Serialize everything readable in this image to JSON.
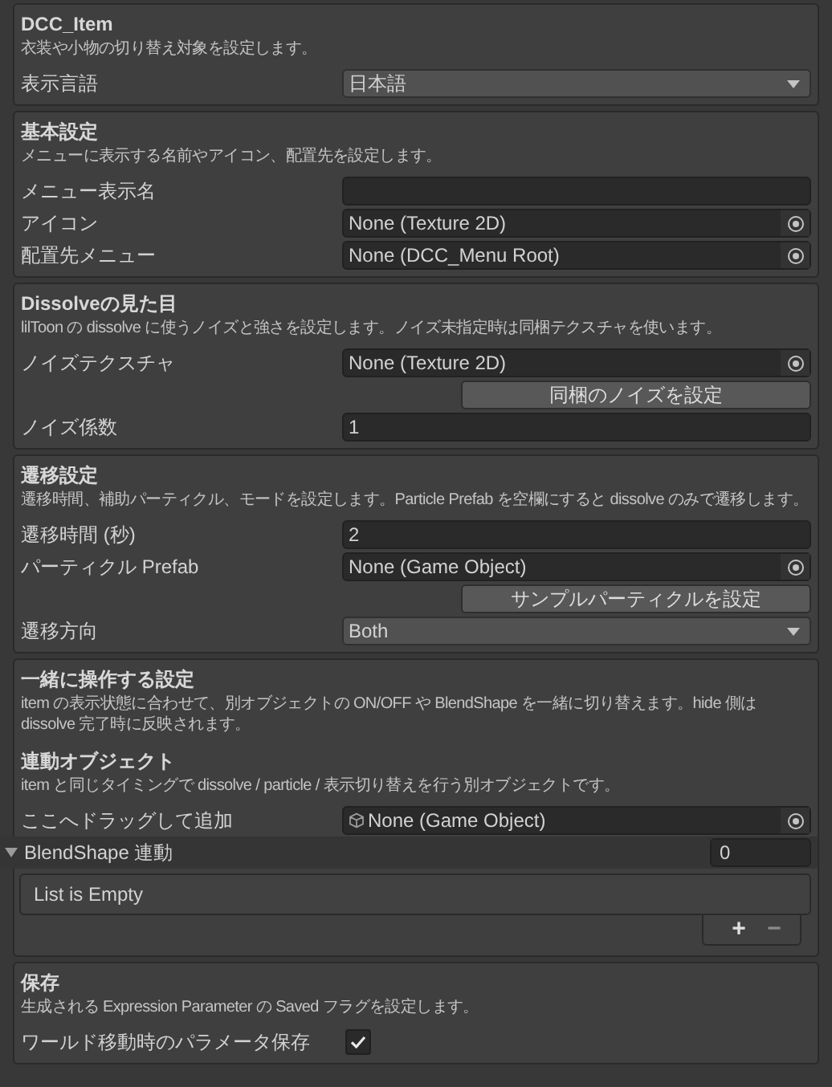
{
  "sections": [
    {
      "title": "DCC_Item",
      "description": "衣装や小物の切り替え対象を設定します。",
      "rows": [
        {
          "kind": "dropdown",
          "label": "表示言語",
          "value": "日本語"
        }
      ]
    },
    {
      "title": "基本設定",
      "description": "メニューに表示する名前やアイコン、配置先を設定します。",
      "rows": [
        {
          "kind": "text",
          "label": "メニュー表示名"
        },
        {
          "kind": "object",
          "label": "アイコン",
          "value": "None (Texture 2D)"
        },
        {
          "kind": "object",
          "label": "配置先メニュー",
          "value": "None (DCC_Menu Root)"
        }
      ]
    },
    {
      "title": "Dissolveの見た目",
      "description": "lilToon の dissolve に使うノイズと強さを設定します。ノイズ未指定時は同梱テクスチャを使います。",
      "rows": [
        {
          "kind": "object",
          "label": "ノイズテクスチャ",
          "value": "None (Texture 2D)"
        },
        {
          "kind": "button",
          "label": "同梱のノイズを設定"
        },
        {
          "kind": "text",
          "label": "ノイズ係数",
          "value": "1"
        }
      ]
    },
    {
      "title": "遷移設定",
      "description": "遷移時間、補助パーティクル、モードを設定します。Particle Prefab を空欄にすると dissolve のみで遷移します。",
      "rows": [
        {
          "kind": "text",
          "label": "遷移時間 (秒)",
          "value": "2"
        },
        {
          "kind": "object",
          "label": "パーティクル Prefab",
          "value": "None (Game Object)"
        },
        {
          "kind": "button",
          "label": "サンプルパーティクルを設定"
        },
        {
          "kind": "dropdown",
          "label": "遷移方向",
          "value": "Both"
        }
      ]
    },
    {
      "title": "一緒に操作する設定",
      "description": "item の表示状態に合わせて、別オブジェクトの ON/OFF や BlendShape を一緒に切り替えます。hide 側は dissolve 完了時に反映されます。",
      "rows": [
        {
          "kind": "subheading",
          "title": "連動オブジェクト",
          "description": "item と同じタイミングで dissolve / particle / 表示切り替えを行う別オブジェクトです。"
        },
        {
          "kind": "typed_object",
          "label": "ここへドラッグして追加",
          "value": "None (Game Object)"
        },
        {
          "kind": "list",
          "title": "BlendShape 連動",
          "expanded": true,
          "count": "0",
          "empty_text": "List is Empty",
          "add": "+",
          "remove": "−"
        }
      ]
    },
    {
      "title": "保存",
      "description": "生成される Expression Parameter の Saved フラグを設定します。",
      "rows": [
        {
          "kind": "checkbox",
          "label": "ワールド移動時のパラメータ保存",
          "checked": true
        }
      ]
    }
  ]
}
